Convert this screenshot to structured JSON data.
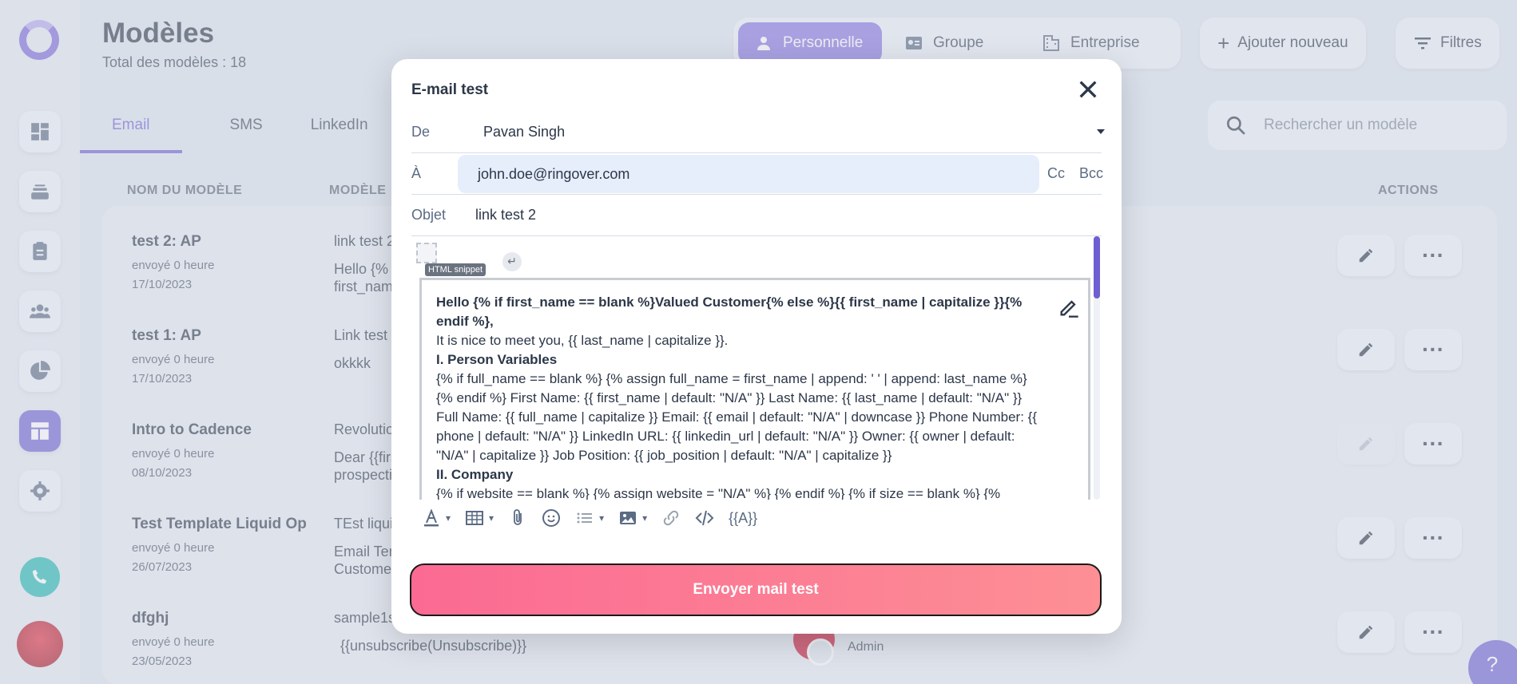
{
  "page": {
    "title": "Modèles",
    "subtitle": "Total des modèles : 18",
    "tabs": [
      "Email",
      "SMS",
      "LinkedIn"
    ],
    "segments": [
      "Personnelle",
      "Groupe",
      "Entreprise"
    ],
    "add_label": "Ajouter nouveau",
    "filter_label": "Filtres",
    "search_placeholder": "Rechercher un modèle",
    "headers": {
      "name": "NOM DU MODÈLE",
      "template": "MODÈLE",
      "actions": "ACTIONS"
    },
    "admin_role": "Admin"
  },
  "rows": [
    {
      "name": "test 2: AP",
      "sent": "envoyé 0 heure",
      "date": "17/10/2023",
      "subject": "link test 2",
      "body": "Hello {% if first_name == blank %}Valued Customer{% else %}{{ first_"
    },
    {
      "name": "test 1: AP",
      "sent": "envoyé 0 heure",
      "date": "17/10/2023",
      "subject": "Link test m",
      "body": "okkkk"
    },
    {
      "name": "Intro to Cadence",
      "sent": "envoyé 0 heure",
      "date": "08/10/2023",
      "subject": "Revolution",
      "body": "Dear {{first s prospecti"
    },
    {
      "name": "Test Template Liquid Op",
      "sent": "envoyé 0 heure",
      "date": "26/07/2023",
      "subject": "TEst liquid",
      "body": "Email Temp Customer{"
    },
    {
      "name": "dfghj",
      "sent": "envoyé 0 heure",
      "date": "23/05/2023",
      "subject": "sample1se",
      "body": "{{unsubscribe(Unsubscribe)}}"
    }
  ],
  "modal": {
    "title": "E-mail test",
    "from_label": "De",
    "from_value": "Pavan Singh",
    "to_label": "À",
    "to_value": "john.doe@ringover.com",
    "cc_label": "Cc",
    "bcc_label": "Bcc",
    "subject_label": "Objet",
    "subject_value": "link test 2",
    "snippet_label": "HTML snippet",
    "body_line1": "Hello {% if first_name == blank %}Valued Customer{% else %}{{ first_name | capitalize }}{% endif %},",
    "body_line2": "It is nice to meet you, {{ last_name | capitalize }}.",
    "body_h1": "I. Person Variables",
    "body_p1": "{% if full_name == blank %} {% assign full_name = first_name | append: ' ' | append: last_name %} {% endif %} First Name: {{ first_name | default: \"N/A\" }} Last Name: {{ last_name | default: \"N/A\" }} Full Name: {{ full_name | capitalize }} Email: {{ email | default: \"N/A\" | downcase }} Phone Number: {{ phone | default: \"N/A\" }} LinkedIn URL: {{ linkedin_url | default: \"N/A\" }} Owner: {{ owner | default: \"N/A\" | capitalize }} Job Position: {{ job_position | default: \"N/A\" | capitalize }}",
    "body_h2": "II. Company",
    "body_p2": "{% if website == blank %} {% assign website = \"N/A\" %} {% endif %} {% if size == blank %} {%",
    "var_label": "{{A}}",
    "send_label": "Envoyer mail test"
  },
  "colors": {
    "accent": "#6d5fd2",
    "send_start": "#fb6a93",
    "send_end": "#fd8f95",
    "to_bg": "#e6eefc"
  }
}
